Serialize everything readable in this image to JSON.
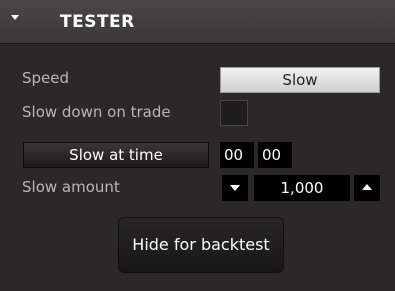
{
  "header": {
    "title": "TESTER",
    "collapse_icon": "triangle-down-icon"
  },
  "speed": {
    "label": "Speed",
    "value": "Slow"
  },
  "slow_on_trade": {
    "label": "Slow down on trade",
    "checked": false
  },
  "slow_at_time": {
    "button_label": "Slow at time",
    "hour": "00",
    "minute": "00"
  },
  "slow_amount": {
    "label": "Slow amount",
    "value": "1,000",
    "decrease_icon": "triangle-down-icon",
    "increase_icon": "triangle-up-icon"
  },
  "hide_button": {
    "label": "Hide for backtest"
  },
  "colors": {
    "panel_bg": "#2c2827",
    "header_bg": "#423e3f",
    "label_text": "#b9b6b4",
    "field_bg": "#000000"
  }
}
